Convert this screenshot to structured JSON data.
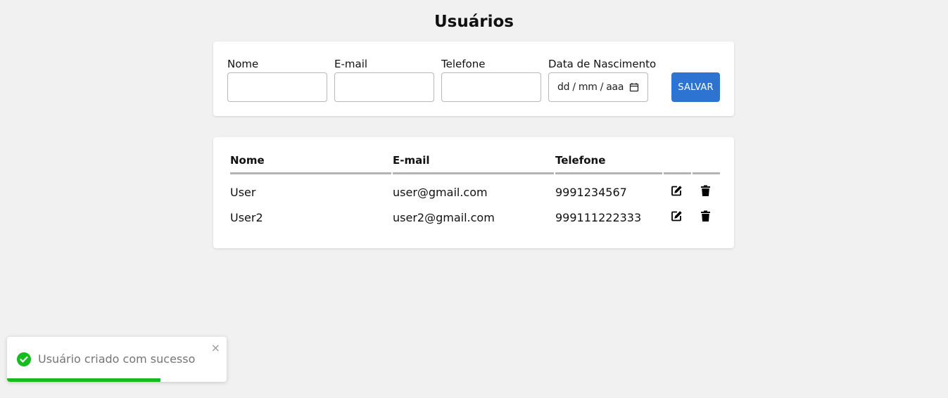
{
  "page": {
    "title": "Usuários"
  },
  "form": {
    "fields": [
      {
        "label": "Nome",
        "value": "",
        "placeholder": ""
      },
      {
        "label": "E-mail",
        "value": "",
        "placeholder": ""
      },
      {
        "label": "Telefone",
        "value": "",
        "placeholder": ""
      },
      {
        "label": "Data de Nascimento",
        "value": "",
        "placeholder": "dd / mm / aaaa",
        "display": "dd / mm / aaa"
      }
    ],
    "save_label": "SALVAR"
  },
  "table": {
    "columns": [
      "Nome",
      "E-mail",
      "Telefone",
      "",
      ""
    ],
    "rows": [
      {
        "nome": "User",
        "email": "user@gmail.com",
        "telefone": "9991234567"
      },
      {
        "nome": "User2",
        "email": "user2@gmail.com",
        "telefone": "999111222333"
      }
    ],
    "actions": [
      "edit-icon",
      "trash-icon"
    ]
  },
  "toast": {
    "message": "Usuário criado com sucesso",
    "close_symbol": "×",
    "icon": "check-circle-icon",
    "progress": 0.7
  },
  "colors": {
    "primary": "#2d74d2",
    "success": "#15bb1f",
    "background": "#f1f1f1"
  }
}
